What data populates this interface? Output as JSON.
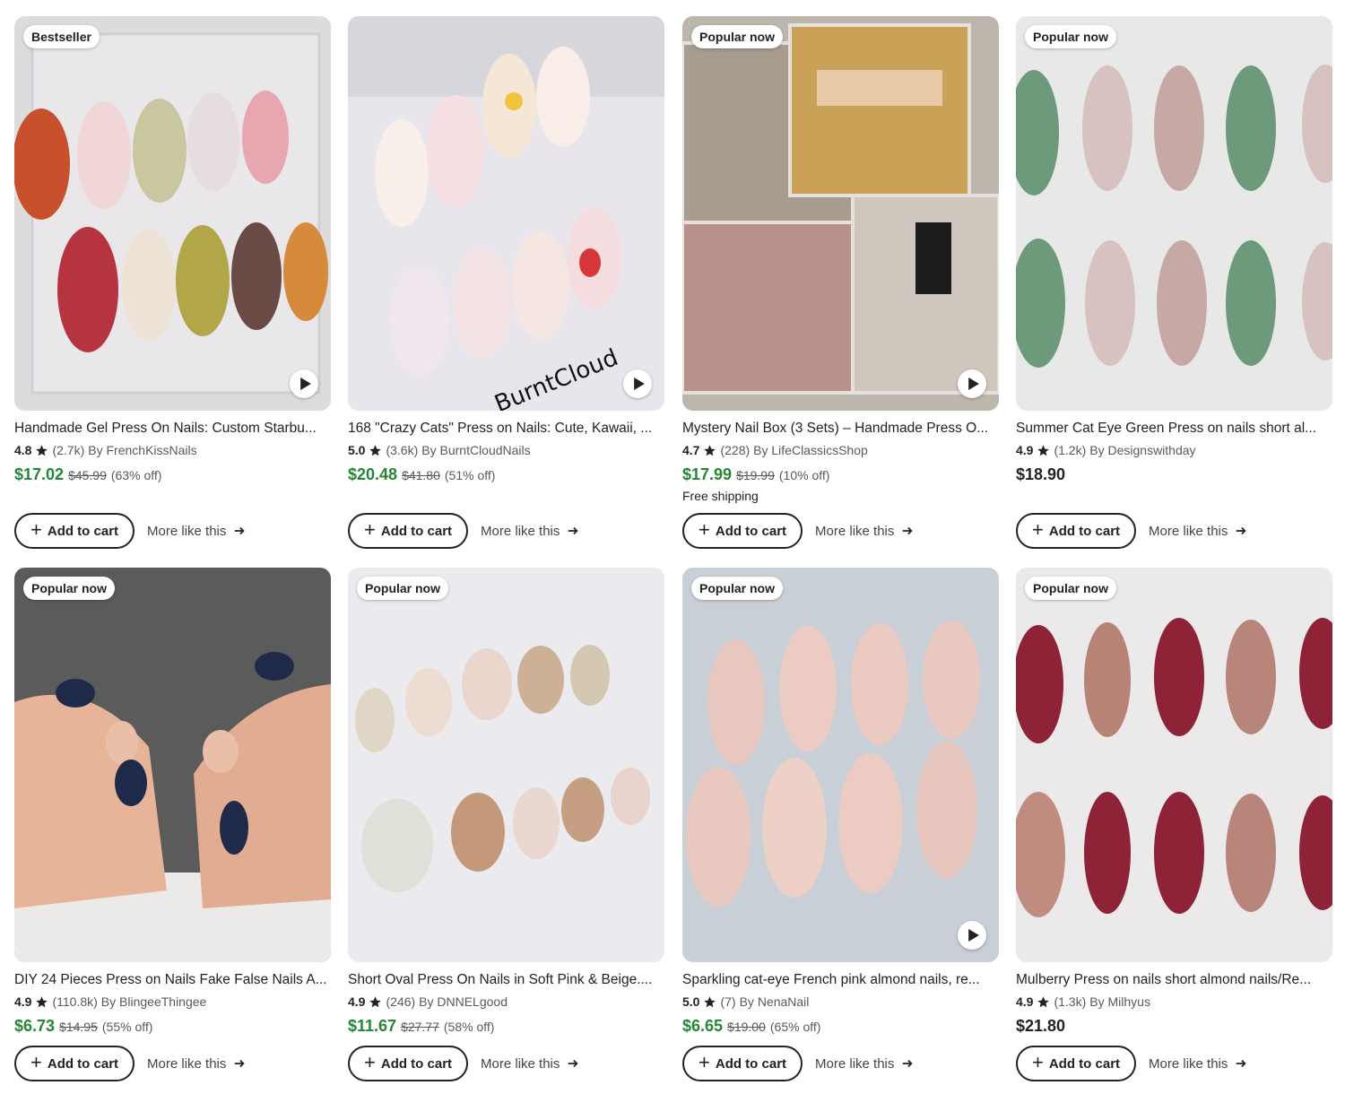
{
  "labels": {
    "add_to_cart": "Add to cart",
    "more_like_this": "More like this"
  },
  "colors": {
    "sale_price": "#258635",
    "text": "#222222",
    "muted": "#595959"
  },
  "listings": [
    {
      "badge": "Bestseller",
      "title": "Handmade Gel Press On Nails: Custom Starbu...",
      "rating": "4.8",
      "reviews": "(2.7k)",
      "shop": "By FrenchKissNails",
      "price": "$17.02",
      "original_price": "$45.99",
      "discount": "(63% off)",
      "shipping": "",
      "has_video": true
    },
    {
      "badge": "",
      "title": "168 \"Crazy Cats\" Press on Nails: Cute, Kawaii, ...",
      "rating": "5.0",
      "reviews": "(3.6k)",
      "shop": "By BurntCloudNails",
      "price": "$20.48",
      "original_price": "$41.80",
      "discount": "(51% off)",
      "shipping": "",
      "has_video": true,
      "watermark": "BurntCloud"
    },
    {
      "badge": "Popular now",
      "title": "Mystery Nail Box (3 Sets) – Handmade Press O...",
      "rating": "4.7",
      "reviews": "(228)",
      "shop": "By LifeClassicsShop",
      "price": "$17.99",
      "original_price": "$19.99",
      "discount": "(10% off)",
      "shipping": "Free shipping",
      "has_video": true
    },
    {
      "badge": "Popular now",
      "title": "Summer Cat Eye Green Press on nails short al...",
      "rating": "4.9",
      "reviews": "(1.2k)",
      "shop": "By Designswithday",
      "price": "$18.90",
      "original_price": "",
      "discount": "",
      "shipping": "",
      "has_video": false
    },
    {
      "badge": "Popular now",
      "title": "DIY 24 Pieces Press on Nails Fake False Nails A...",
      "rating": "4.9",
      "reviews": "(110.8k)",
      "shop": "By BlingeeThingee",
      "price": "$6.73",
      "original_price": "$14.95",
      "discount": "(55% off)",
      "shipping": "",
      "has_video": false
    },
    {
      "badge": "Popular now",
      "title": "Short Oval Press On Nails in Soft Pink & Beige....",
      "rating": "4.9",
      "reviews": "(246)",
      "shop": "By DNNELgood",
      "price": "$11.67",
      "original_price": "$27.77",
      "discount": "(58% off)",
      "shipping": "",
      "has_video": false
    },
    {
      "badge": "Popular now",
      "title": "Sparkling cat-eye French pink almond nails, re...",
      "rating": "5.0",
      "reviews": "(7)",
      "shop": "By NenaNail",
      "price": "$6.65",
      "original_price": "$19.00",
      "discount": "(65% off)",
      "shipping": "",
      "has_video": true
    },
    {
      "badge": "Popular now",
      "title": "Mulberry Press on nails short almond nails/Re...",
      "rating": "4.9",
      "reviews": "(1.3k)",
      "shop": "By Milhyus",
      "price": "$21.80",
      "original_price": "",
      "discount": "",
      "shipping": "",
      "has_video": false
    }
  ]
}
